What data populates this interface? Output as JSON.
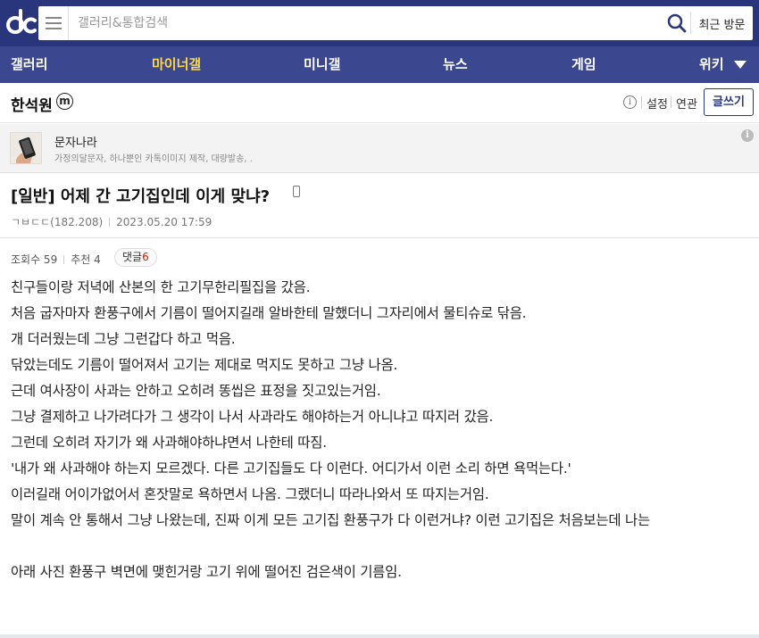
{
  "header": {
    "search_placeholder": "갤러리&통합검색",
    "recent_label": "최근 방문"
  },
  "nav": {
    "items": [
      {
        "label": "갤러리"
      },
      {
        "label": "마이너갤"
      },
      {
        "label": "미니갤"
      },
      {
        "label": "뉴스"
      },
      {
        "label": "게임"
      },
      {
        "label": "위키"
      }
    ]
  },
  "gallery": {
    "title": "한석원",
    "badge": "m",
    "info_glyph": "i",
    "settings_label": "설정",
    "related_label": "연관",
    "write_label": "글쓰기"
  },
  "ad": {
    "title": "문자나라",
    "description": "가정의달문자, 하나뿐인 카톡이미지 제작, 대량발송, .",
    "info_glyph": "i"
  },
  "post": {
    "title": "[일반] 어제 간 고기집인데 이게 맞냐?",
    "author": "ㄱㅂㄷㄷ(182.208)",
    "datetime": "2023.05.20 17:59",
    "views_label": "조회수 59",
    "recommend_label": "추천 4",
    "comment_label": "댓글",
    "comment_count": "6",
    "body": [
      "친구들이랑 저녁에 산본의 한 고기무한리필집을 갔음.",
      "처음 굽자마자 환풍구에서 기름이 떨어지길래 알바한테 말했더니 그자리에서 물티슈로 닦음.",
      "개 더러웠는데 그냥 그런갑다 하고 먹음.",
      "닦았는데도 기름이 떨어져서 고기는 제대로 먹지도 못하고 그냥 나옴.",
      "근데 여사장이 사과는 안하고 오히려 똥씹은 표정을 짓고있는거임.",
      "그냥 결제하고 나가려다가 그 생각이 나서 사과라도 해야하는거 아니냐고 따지러 갔음.",
      "그런데 오히려 자기가 왜 사과해야하냐면서 나한테 따짐.",
      "'내가 왜 사과해야 하는지 모르겠다. 다른 고기집들도 다 이런다. 어디가서 이런 소리 하면 욕먹는다.'",
      "이러길래 어이가없어서 혼잣말로 욕하면서 나옴. 그랬더니 따라나와서 또 따지는거임.",
      "말이 계속 안 통해서 그냥 나왔는데, 진짜 이게 모든 고기집 환풍구가 다 이런거냐? 이런 고기집은 처음보는데 나는",
      "",
      "아래 사진 환풍구 벽면에 맺힌거랑 고기 위에 떨어진 검은색이 기름임."
    ]
  },
  "colors": {
    "brand": "#29367c",
    "nav": "#3b4890",
    "active_nav": "#ffd84a",
    "comment_count": "#d31900"
  }
}
